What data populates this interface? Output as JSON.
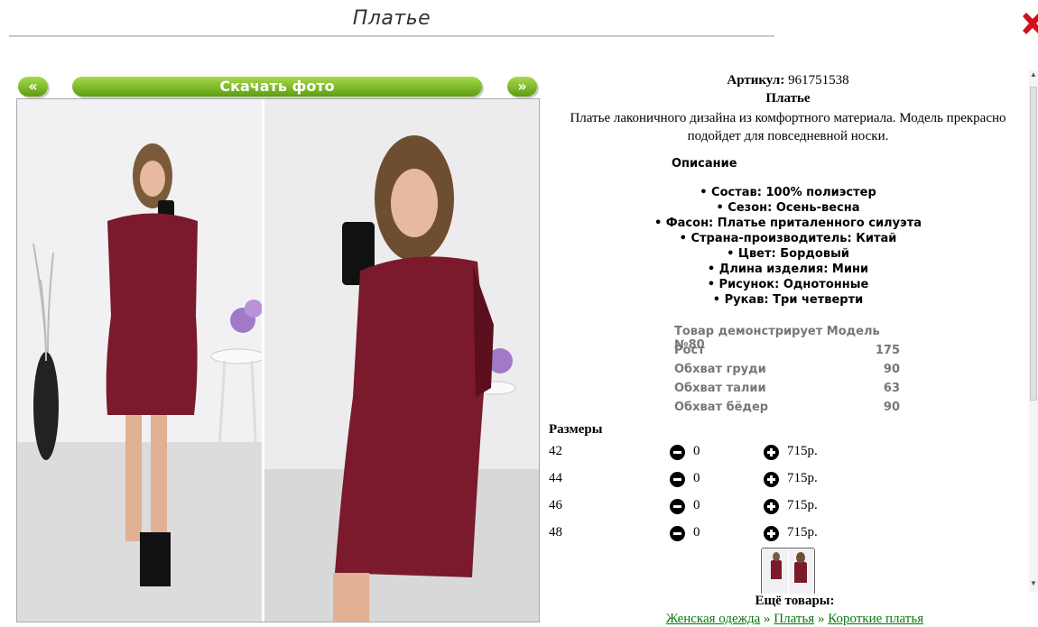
{
  "header": {
    "title": "Платье"
  },
  "gallery": {
    "prev_label": "«",
    "download_label": "Скачать фото",
    "next_label": "»"
  },
  "product": {
    "sku_label": "Артикул:",
    "sku_value": "961751538",
    "name": "Платье",
    "description": "Платье лаконичного дизайна из комфортного материала. Модель прекрасно подойдет для повседневной носки."
  },
  "specs": {
    "heading": "Описание",
    "items": [
      "• Состав: 100% полиэстер",
      "• Сезон: Осень-весна",
      "• Фасон: Платье приталенного силуэта",
      "• Страна-производитель: Китай",
      "• Цвет: Бордовый",
      "• Длина изделия: Мини",
      "• Рисунок: Однотонные",
      "• Рукав: Три четверти"
    ]
  },
  "model": {
    "rows": [
      {
        "label": "Товар демонстрирует Модель №80",
        "value": ""
      },
      {
        "label": "Рост",
        "value": "175"
      },
      {
        "label": "Обхват груди",
        "value": "90"
      },
      {
        "label": "Обхват талии",
        "value": "63"
      },
      {
        "label": "Обхват бёдер",
        "value": "90"
      }
    ]
  },
  "sizes": {
    "title": "Размеры",
    "rows": [
      {
        "size": "42",
        "qty": "0",
        "price": "715р."
      },
      {
        "size": "44",
        "qty": "0",
        "price": "715р."
      },
      {
        "size": "46",
        "qty": "0",
        "price": "715р."
      },
      {
        "size": "48",
        "qty": "0",
        "price": "715р."
      }
    ]
  },
  "more": {
    "title": "Ещё товары:",
    "crumbs": [
      "Женская одежда",
      "Платья",
      "Короткие платья"
    ],
    "separator": "»"
  },
  "colors": {
    "accent_green_top": "#a6da4c",
    "accent_green_bottom": "#5d9d10",
    "dress": "#7a1a2c",
    "link_green": "#0a7a0a",
    "close_red": "#d0101a"
  },
  "icons": [
    "close-icon",
    "minus-circle-icon",
    "plus-circle-icon",
    "scroll-up-arrow-icon",
    "scroll-down-arrow-icon"
  ]
}
